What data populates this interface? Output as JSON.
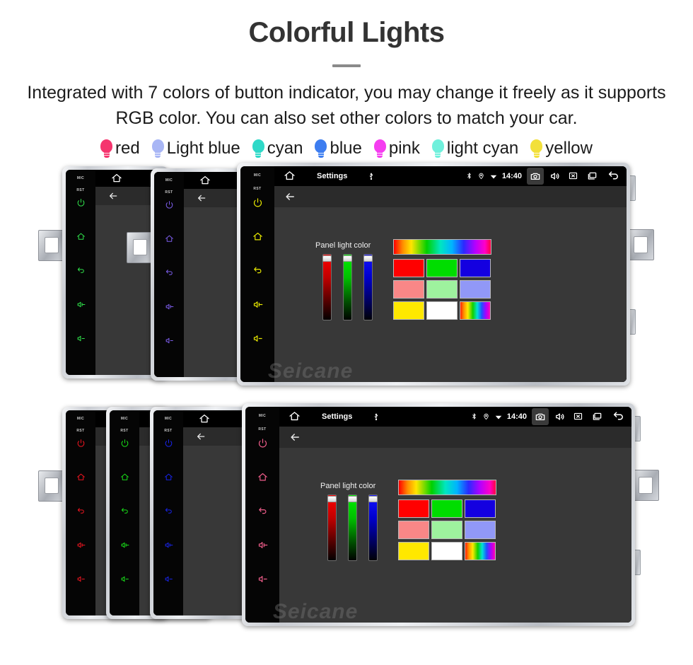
{
  "header": {
    "title": "Colorful Lights",
    "subtitle": "Integrated with 7 colors of button indicator, you may change it freely as it supports RGB color. You can also set other colors to match your car."
  },
  "legend": {
    "items": [
      {
        "label": "red",
        "color": "#f5356e"
      },
      {
        "label": "Light blue",
        "color": "#a8b6f5"
      },
      {
        "label": "cyan",
        "color": "#2fd9c8"
      },
      {
        "label": "blue",
        "color": "#3d7df0"
      },
      {
        "label": "pink",
        "color": "#f53df0"
      },
      {
        "label": "light cyan",
        "color": "#6ff0dc"
      },
      {
        "label": "yellow",
        "color": "#f2e03a"
      }
    ]
  },
  "device": {
    "side_buttons": {
      "mic_label": "MIC",
      "rst_label": "RST",
      "icons": [
        "power-icon",
        "home-icon",
        "back-icon",
        "volume-up-icon",
        "volume-down-icon"
      ],
      "glyphs": [
        "⏻",
        "⌂",
        "↩",
        "◂+",
        "◂-"
      ]
    },
    "statusbar": {
      "home_icon": "home-icon",
      "title": "Settings",
      "usb_icon": "usb-icon",
      "bluetooth_icon": "bluetooth-icon",
      "location_icon": "location-icon",
      "wifi_icon": "wifi-icon",
      "time": "14:40",
      "camera_icon": "camera-icon",
      "volume_icon": "volume-icon",
      "close_icon": "close-box-icon",
      "recents_icon": "recents-icon",
      "back_icon": "back-arrow-icon"
    },
    "appbar": {
      "back_icon": "back-arrow-icon"
    },
    "panel": {
      "label": "Panel light color",
      "sliders": [
        {
          "name": "red-slider",
          "color": "#ff0000"
        },
        {
          "name": "green-slider",
          "color": "#00f000"
        },
        {
          "name": "blue-slider",
          "color": "#1414ff"
        }
      ],
      "gradient_bar": "rainbow-gradient",
      "swatches": [
        {
          "name": "swatch-red",
          "color": "#ff0000"
        },
        {
          "name": "swatch-green",
          "color": "#00dd00"
        },
        {
          "name": "swatch-blue",
          "color": "#1400e0"
        },
        {
          "name": "swatch-light-red",
          "color": "#f98787"
        },
        {
          "name": "swatch-light-green",
          "color": "#9ef29e"
        },
        {
          "name": "swatch-light-blue",
          "color": "#9198f7"
        },
        {
          "name": "swatch-yellow",
          "color": "#ffe800"
        },
        {
          "name": "swatch-white",
          "color": "#ffffff"
        },
        {
          "name": "swatch-rainbow",
          "color": "rainbow"
        }
      ]
    },
    "watermark": "Seicane"
  },
  "rows": {
    "top": {
      "units": [
        {
          "name": "unit-green",
          "button_color": "#2fe04a",
          "size": "small"
        },
        {
          "name": "unit-purple",
          "button_color": "#7b5ce8",
          "size": "small"
        },
        {
          "name": "unit-yellow",
          "button_color": "#e8e800",
          "size": "large"
        }
      ]
    },
    "bottom": {
      "units": [
        {
          "name": "unit-red",
          "button_color": "#ee1520",
          "size": "small"
        },
        {
          "name": "unit-green",
          "button_color": "#19dd19",
          "size": "small"
        },
        {
          "name": "unit-blue",
          "button_color": "#1824e8",
          "size": "small"
        },
        {
          "name": "unit-pink",
          "button_color": "#ef5d8a",
          "size": "large"
        }
      ]
    }
  }
}
